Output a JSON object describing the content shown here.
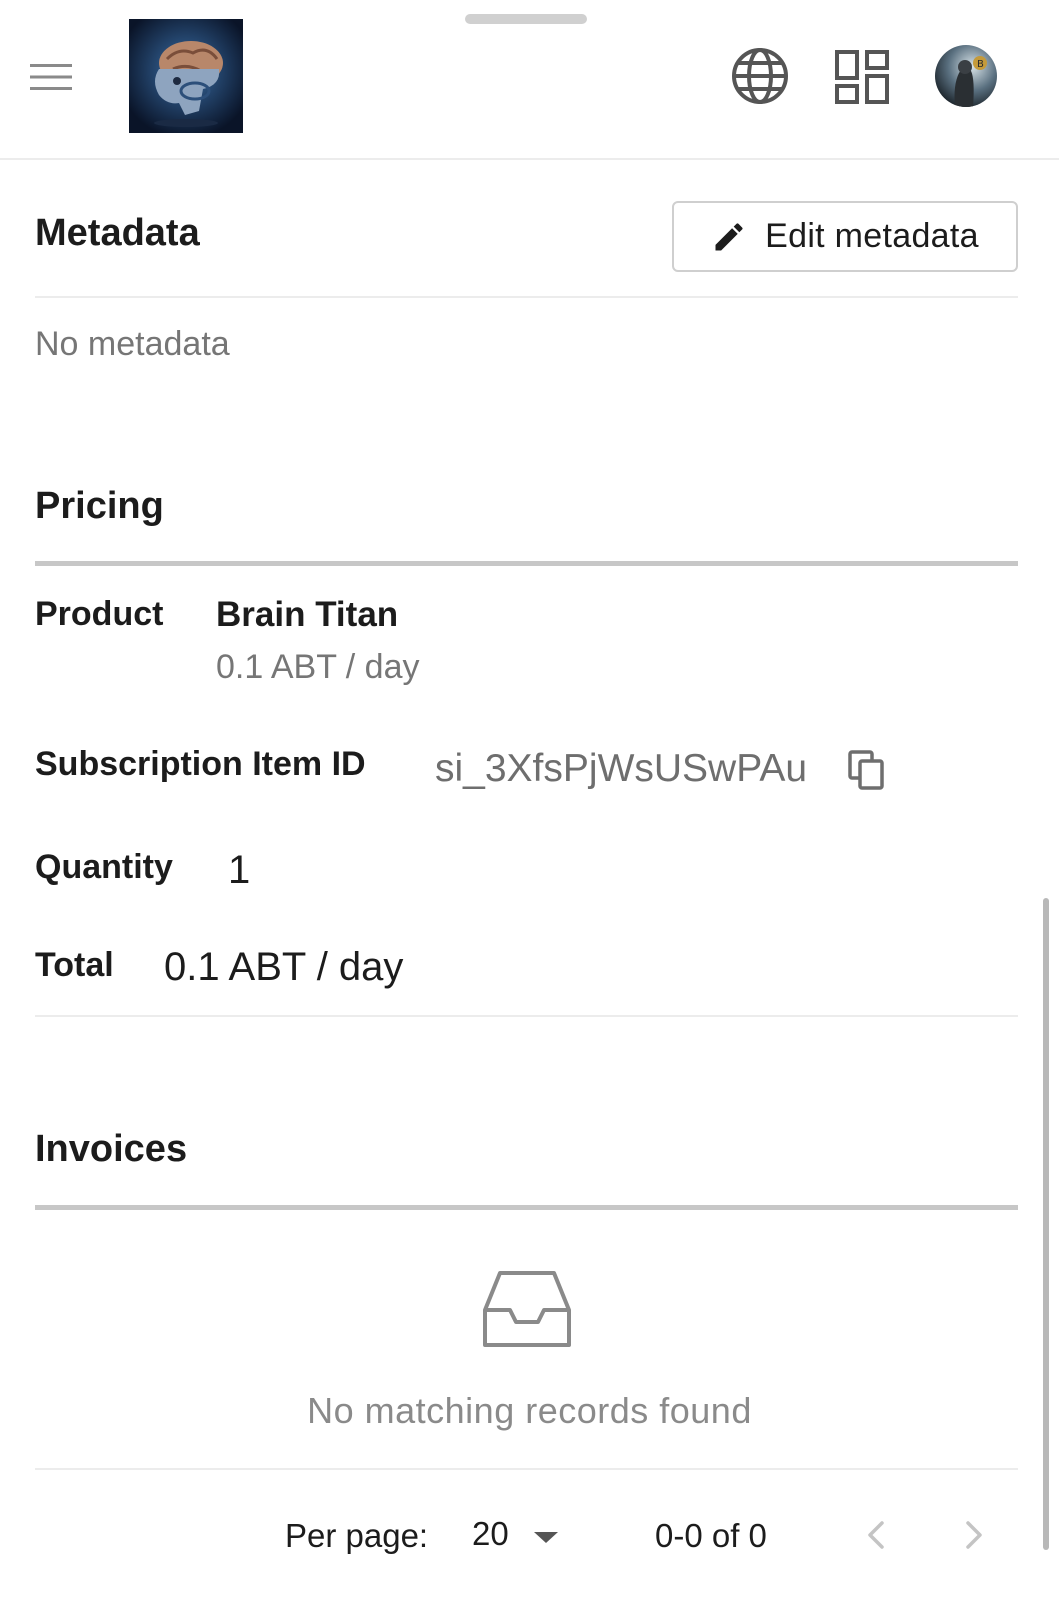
{
  "header": {
    "menu_icon": "hamburger-menu-icon",
    "logo_icon": "brain-titan-logo",
    "language_icon": "globe-icon",
    "apps_icon": "dashboard-grid-icon",
    "avatar_icon": "user-avatar"
  },
  "metadata": {
    "title": "Metadata",
    "edit_label": "Edit metadata",
    "empty_text": "No metadata"
  },
  "pricing": {
    "title": "Pricing",
    "product_label": "Product",
    "product_name": "Brain Titan",
    "product_price": "0.1 ABT / day",
    "subscription_item_label": "Subscription Item ID",
    "subscription_item_id": "si_3XfsPjWsUSwPAu",
    "quantity_label": "Quantity",
    "quantity_value": "1",
    "total_label": "Total",
    "total_value": "0.1 ABT / day"
  },
  "invoices": {
    "title": "Invoices",
    "empty_text": "No matching records found",
    "per_page_label": "Per page:",
    "per_page_value": "20",
    "range_text": "0-0 of 0"
  },
  "colors": {
    "text": "#1c1c1c",
    "muted": "#767676",
    "divider": "#c7c7c7"
  }
}
